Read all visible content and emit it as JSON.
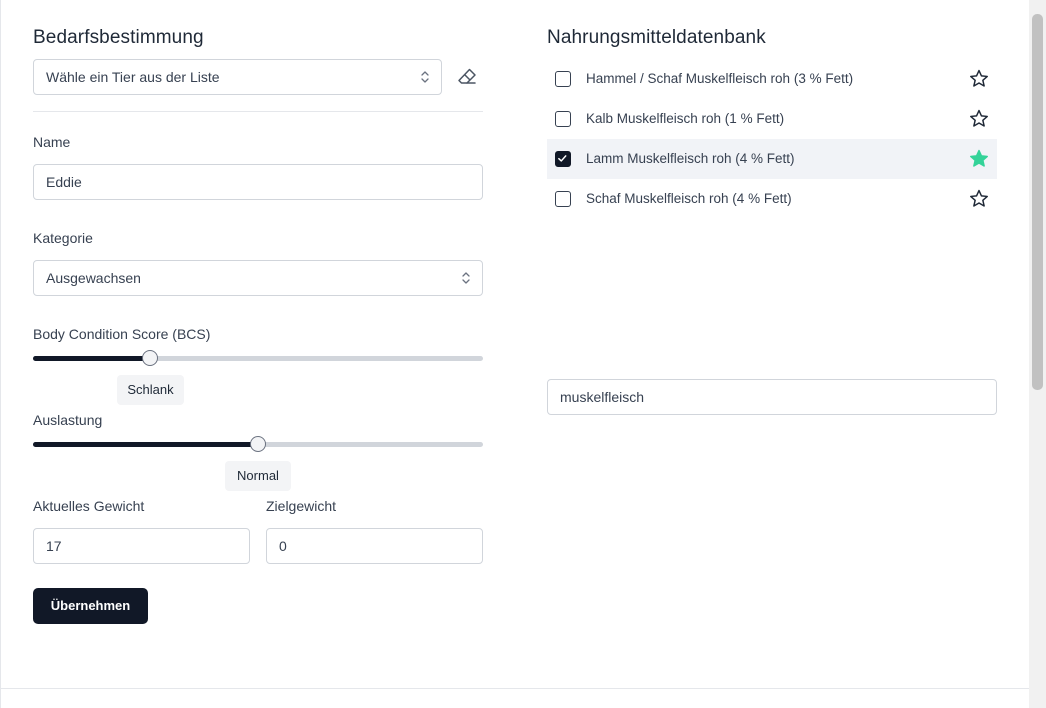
{
  "left": {
    "title": "Bedarfsbestimmung",
    "animal_select": {
      "value": "Wähle ein Tier aus der Liste"
    },
    "name": {
      "label": "Name",
      "value": "Eddie"
    },
    "category": {
      "label": "Kategorie",
      "value": "Ausgewachsen"
    },
    "bcs": {
      "label": "Body Condition Score (BCS)",
      "value_label": "Schlank",
      "fraction": 0.26
    },
    "utilization": {
      "label": "Auslastung",
      "value_label": "Normal",
      "fraction": 0.5
    },
    "current_weight": {
      "label": "Aktuelles Gewicht",
      "value": "17"
    },
    "target_weight": {
      "label": "Zielgewicht",
      "value": "0"
    },
    "apply_label": "Übernehmen"
  },
  "right": {
    "title": "Nahrungsmitteldatenbank",
    "foods": [
      {
        "name": "Hammel / Schaf Muskelfleisch roh (3 % Fett)",
        "checked": false,
        "favorite": false
      },
      {
        "name": "Kalb Muskelfleisch roh (1 % Fett)",
        "checked": false,
        "favorite": false
      },
      {
        "name": "Lamm Muskelfleisch roh (4 % Fett)",
        "checked": true,
        "favorite": true
      },
      {
        "name": "Schaf Muskelfleisch roh (4 % Fett)",
        "checked": false,
        "favorite": false
      }
    ],
    "search": {
      "value": "muskelfleisch"
    }
  },
  "colors": {
    "accent": "#111827",
    "favorite": "#34d399",
    "selected_row": "#f1f3f7"
  }
}
